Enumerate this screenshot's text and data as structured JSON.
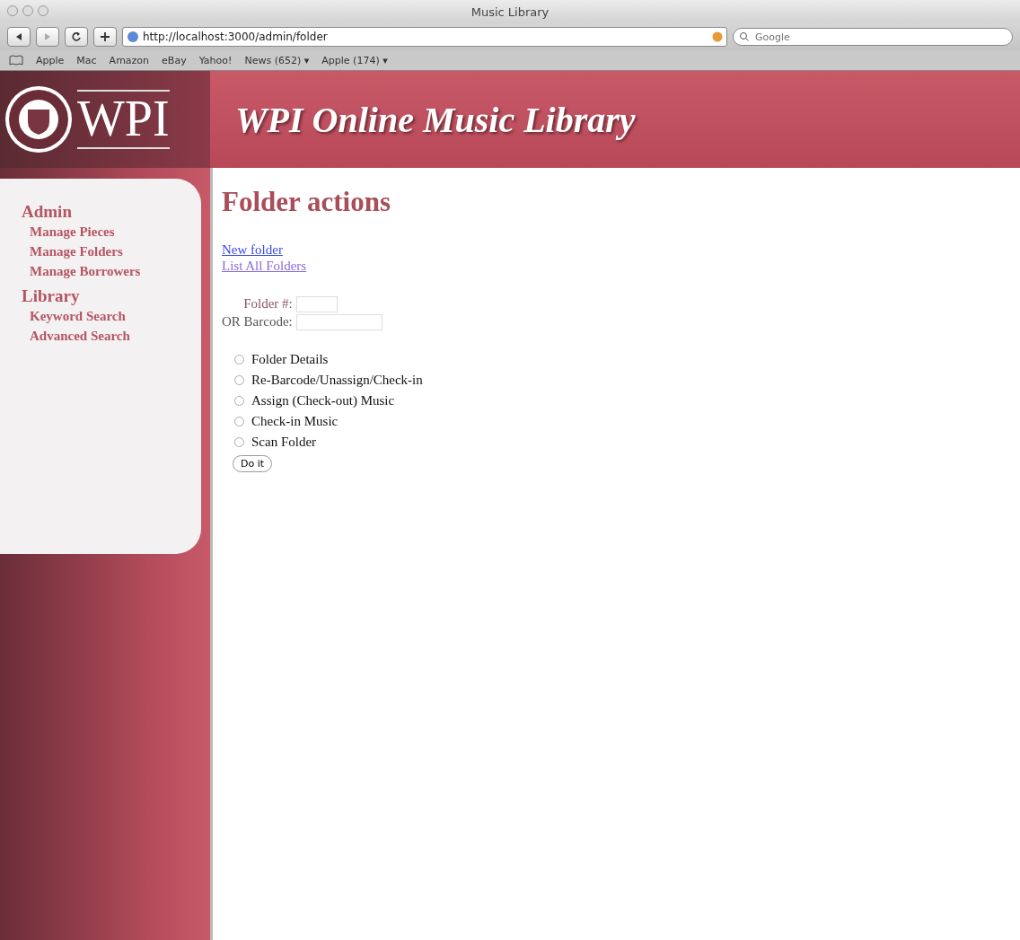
{
  "window": {
    "title": "Music Library"
  },
  "toolbar": {
    "url": "http://localhost:3000/admin/folder",
    "search": {
      "placeholder": "Google"
    }
  },
  "bookmarks": [
    {
      "label": "Apple"
    },
    {
      "label": "Mac"
    },
    {
      "label": "Amazon"
    },
    {
      "label": "eBay"
    },
    {
      "label": "Yahoo!"
    },
    {
      "label": "News (652) ▾"
    },
    {
      "label": "Apple (174) ▾"
    }
  ],
  "header": {
    "logo": "WPI",
    "title": "WPI Online Music Library"
  },
  "sidebar": {
    "sections": [
      {
        "title": "Admin",
        "items": [
          "Manage Pieces",
          "Manage Folders",
          "Manage Borrowers"
        ]
      },
      {
        "title": "Library",
        "items": [
          "Keyword Search",
          "Advanced Search"
        ]
      }
    ]
  },
  "content": {
    "heading": "Folder actions",
    "links": [
      {
        "label": "New folder",
        "visited": false
      },
      {
        "label": "List All Folders",
        "visited": true
      }
    ],
    "fields": [
      {
        "label": "Folder #:"
      },
      {
        "label": "OR Barcode:"
      }
    ],
    "options": [
      {
        "label": "Folder Details",
        "selected": false
      },
      {
        "label": "Re-Barcode/Unassign/Check-in",
        "selected": false
      },
      {
        "label": "Assign (Check-out) Music",
        "selected": false
      },
      {
        "label": "Check-in Music",
        "selected": false
      },
      {
        "label": "Scan Folder",
        "selected": false
      }
    ],
    "submit": "Do it"
  }
}
